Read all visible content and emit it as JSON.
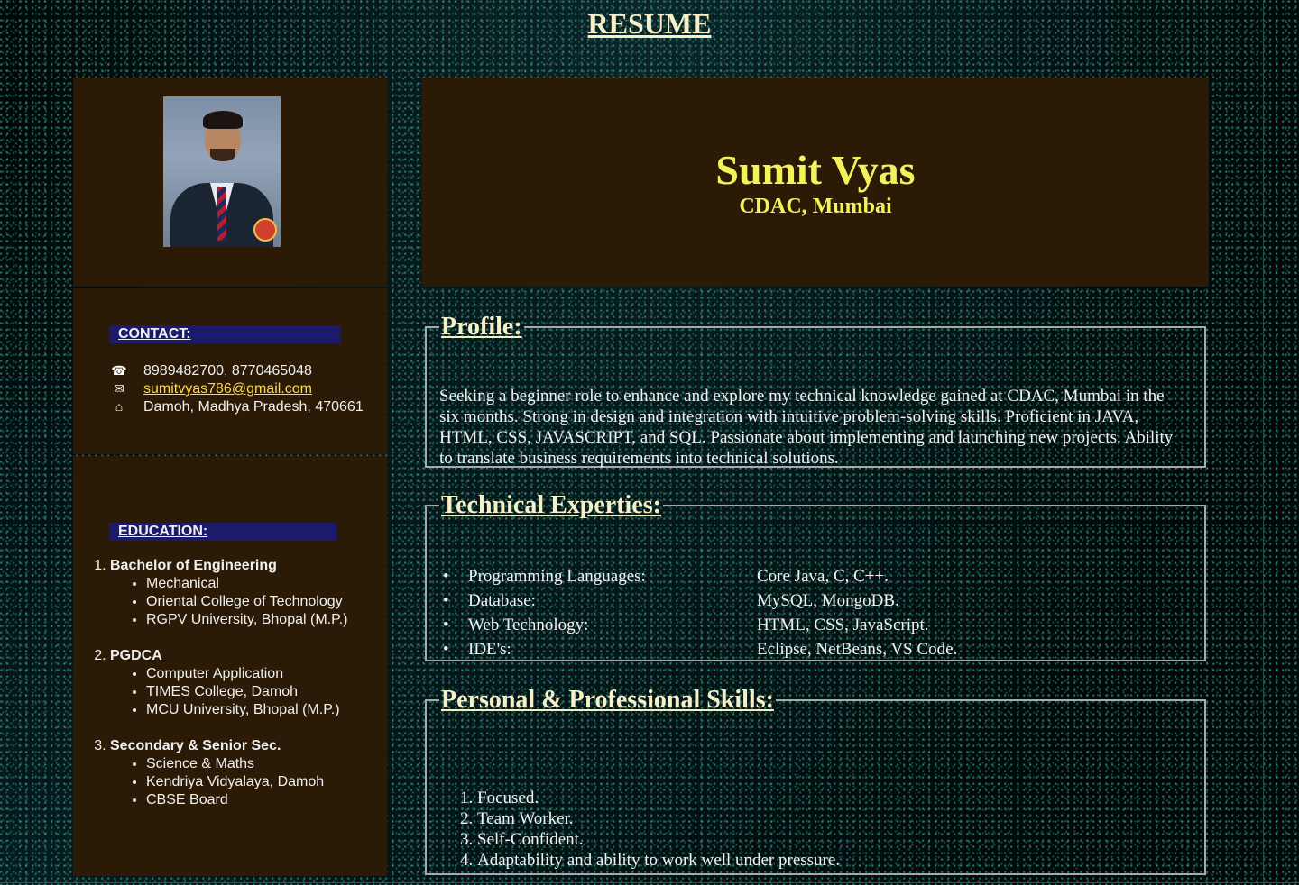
{
  "page": {
    "title": "RESUME"
  },
  "sidebar": {
    "contact": {
      "heading": "CONTACT:",
      "phone_icon": "phone-icon",
      "phone": "8989482700, 8770465048",
      "email_icon": "mail-icon",
      "email": "sumitvyas786@gmail.com",
      "address_icon": "home-icon",
      "address": "Damoh, Madhya Pradesh, 470661"
    },
    "education": {
      "heading": "EDUCATION:",
      "items": [
        {
          "degree": "Bachelor of Engineering",
          "details": [
            "Mechanical",
            "Oriental College of Technology",
            "RGPV University, Bhopal (M.P.)"
          ]
        },
        {
          "degree": "PGDCA",
          "details": [
            "Computer Application",
            "TIMES College, Damoh",
            "MCU University, Bhopal (M.P.)"
          ]
        },
        {
          "degree": "Secondary & Senior Sec.",
          "details": [
            "Science & Maths",
            "Kendriya Vidyalaya, Damoh",
            "CBSE Board"
          ]
        }
      ]
    }
  },
  "header": {
    "name": "Sumit Vyas",
    "organization": "CDAC, Mumbai"
  },
  "profile": {
    "heading": "Profile:",
    "text": "Seeking a beginner role to enhance and explore my technical knowledge gained at CDAC, Mumbai in the six months. Strong in design and integration with intuitive problem-solving skills. Proficient in JAVA, HTML, CSS, JAVASCRIPT, and SQL. Passionate about implementing and launching new projects. Ability to translate business requirements into technical solutions."
  },
  "technical": {
    "heading": "Technical Experties:",
    "items": [
      {
        "label": "Programming Languages:",
        "value": "Core Java, C, C++."
      },
      {
        "label": "Database:",
        "value": "MySQL, MongoDB."
      },
      {
        "label": "Web Technology:",
        "value": "HTML, CSS, JavaScript."
      },
      {
        "label": "IDE's:",
        "value": "Eclipse, NetBeans, VS Code."
      }
    ]
  },
  "skills": {
    "heading": "Personal & Professional Skills:",
    "items": [
      "Focused.",
      "Team Worker.",
      "Self-Confident.",
      "Adaptability and ability to work well under pressure."
    ]
  },
  "colors": {
    "panel": "#2b1a05",
    "accent_name": "#f4f15a",
    "label_bg": "#1c1a6a",
    "link": "#ffd84a"
  }
}
